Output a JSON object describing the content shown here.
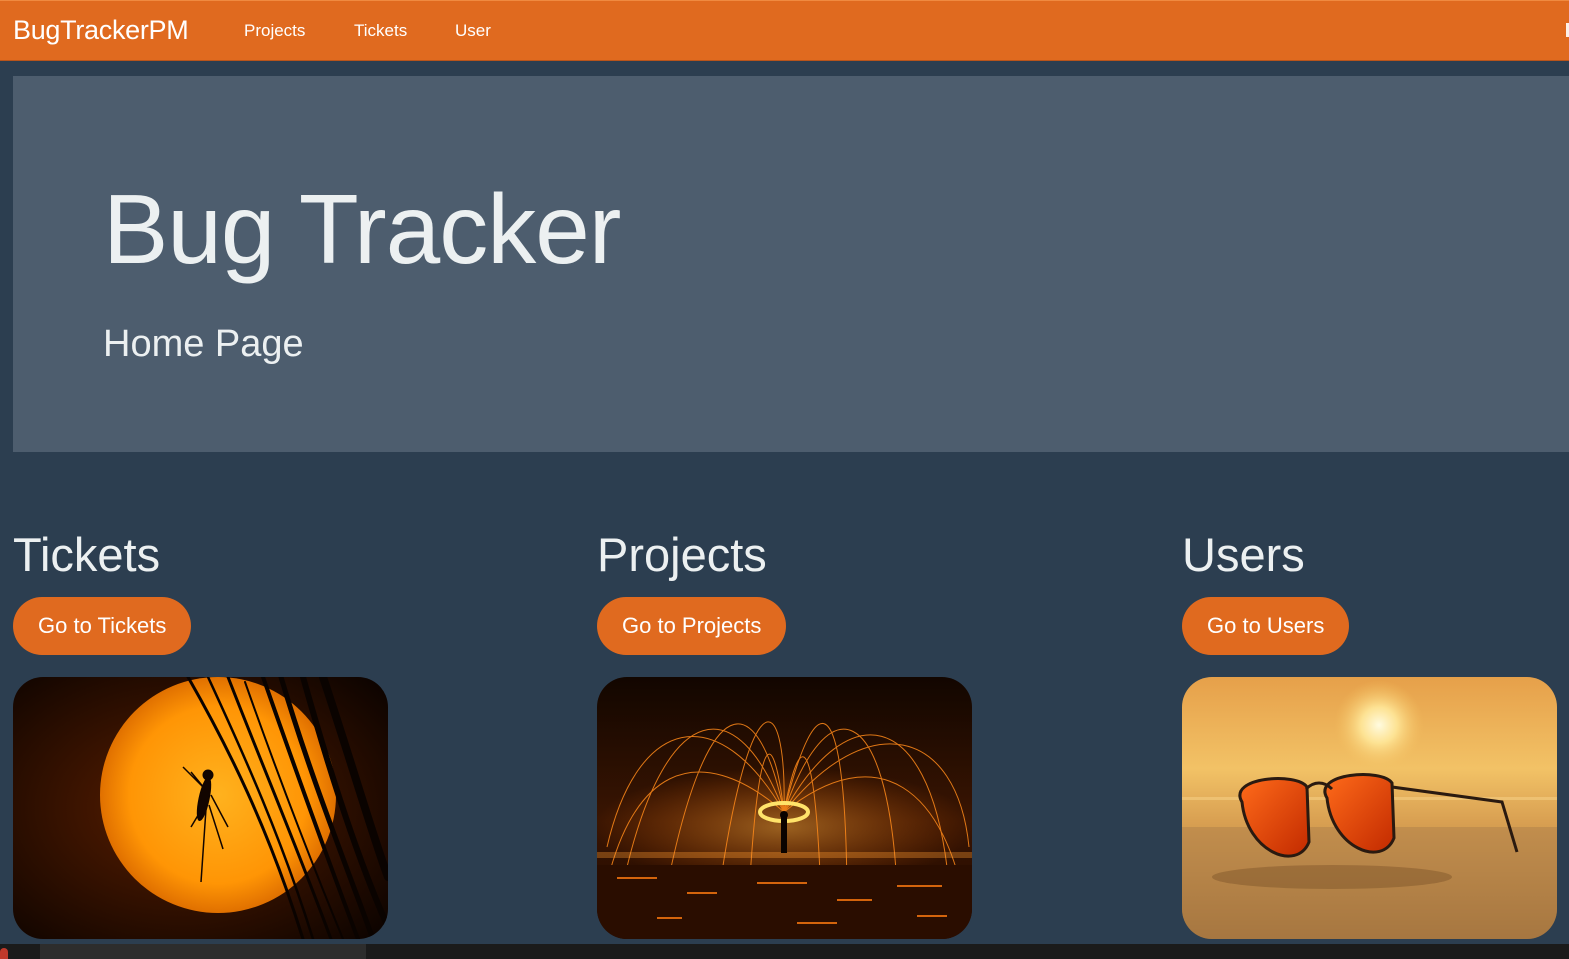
{
  "navbar": {
    "brand": "BugTrackerPM",
    "links": [
      "Projects",
      "Tickets",
      "User"
    ]
  },
  "hero": {
    "title": "Bug Tracker",
    "subtitle": "Home Page"
  },
  "sections": [
    {
      "title": "Tickets",
      "button": "Go to Tickets",
      "image_icon": "mosquito-sunset-photo"
    },
    {
      "title": "Projects",
      "button": "Go to Projects",
      "image_icon": "steel-wool-fire-photo"
    },
    {
      "title": "Users",
      "button": "Go to Users",
      "image_icon": "sunglasses-beach-photo"
    }
  ],
  "colors": {
    "accent": "#e06a1f",
    "background": "#2c3e50",
    "jumbotron": "#4d5d6e",
    "text": "#ecf0f1"
  }
}
